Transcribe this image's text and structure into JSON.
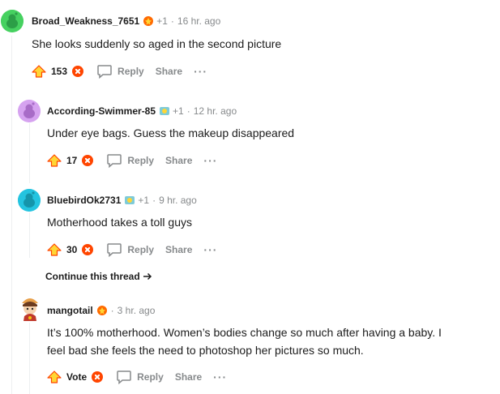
{
  "comments": [
    {
      "username": "Broad_Weakness_7651",
      "plus": "+1",
      "sep": "·",
      "time": "16 hr. ago",
      "text": "She looks suddenly so aged in the second picture",
      "score": "153",
      "reply": "Reply",
      "share": "Share",
      "more": "···",
      "avatar_color": "#46d160"
    },
    {
      "username": "According-Swimmer-85",
      "plus": "+1",
      "sep": "·",
      "time": "12 hr. ago",
      "text": "Under eye bags. Guess the makeup disappeared",
      "score": "17",
      "reply": "Reply",
      "share": "Share",
      "more": "···",
      "avatar_color": "#d6a3f0"
    },
    {
      "username": "BluebirdOk2731",
      "plus": "+1",
      "sep": "·",
      "time": "9 hr. ago",
      "text": "Motherhood takes a toll guys",
      "score": "30",
      "reply": "Reply",
      "share": "Share",
      "more": "···",
      "avatar_color": "#24c4e0"
    },
    {
      "username": "mangotail",
      "sep": "·",
      "time": "3 hr. ago",
      "text_line1": "It’s 100% motherhood. Women’s bodies change so much after having a baby. I",
      "text_line2": "feel bad she feels the need to photoshop her pictures so much.",
      "score": "Vote",
      "reply": "Reply",
      "share": "Share",
      "more": "···"
    }
  ],
  "continue_thread": "Continue this thread",
  "colors": {
    "upvote": "#ff4500",
    "muted": "#878a8c",
    "thread": "#edeff1"
  }
}
